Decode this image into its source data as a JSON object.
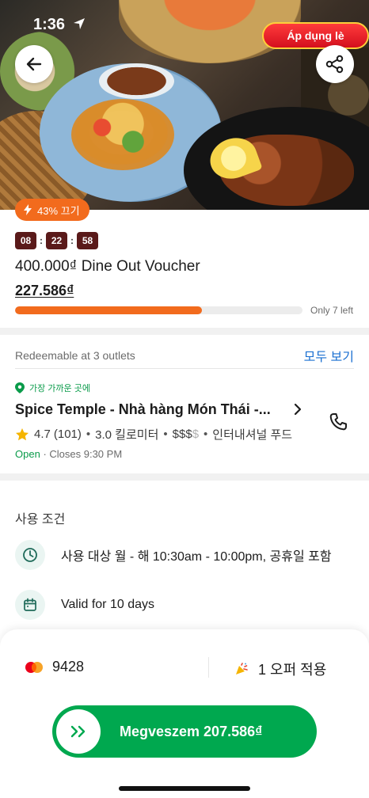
{
  "status_bar": {
    "time": "1:36"
  },
  "hero": {
    "promo_label": "Áp dụng lè"
  },
  "deal": {
    "discount_badge": "43% 끄기",
    "countdown": {
      "hours": "08",
      "minutes": "22",
      "seconds": "58"
    },
    "title": "400.000₫ Dine Out Voucher",
    "price": "227.586₫",
    "progress_fraction": 0.65,
    "stock_label": "Only 7 left"
  },
  "outlets": {
    "label": "Redeemable at 3 outlets",
    "see_all": "모두 보기",
    "nearest_label": "가장 가까운 곳에",
    "name": "Spice Temple - Nhà hàng Món Thái -...",
    "rating": "4.7",
    "reviews": "(101)",
    "distance": "3.0 킬로미터",
    "price_level_active": "$$$",
    "price_level_inactive": "$",
    "cuisine": "인터내셔널 푸드",
    "open_status": "Open",
    "closes": "Closes 9:30 PM"
  },
  "terms": {
    "title": "사용 조건",
    "hours": "사용 대상 월 - 해 10:30am - 10:00pm, 공휴일 포함",
    "validity": "Valid for 10 days"
  },
  "checkout": {
    "card_last4": "9428",
    "offer_label": "1 오퍼 적용",
    "buy_label": "Megveszem 207.586₫"
  },
  "colors": {
    "brand_green": "#00a84f",
    "accent_orange": "#f26b1d",
    "link_blue": "#1a6fd1"
  }
}
